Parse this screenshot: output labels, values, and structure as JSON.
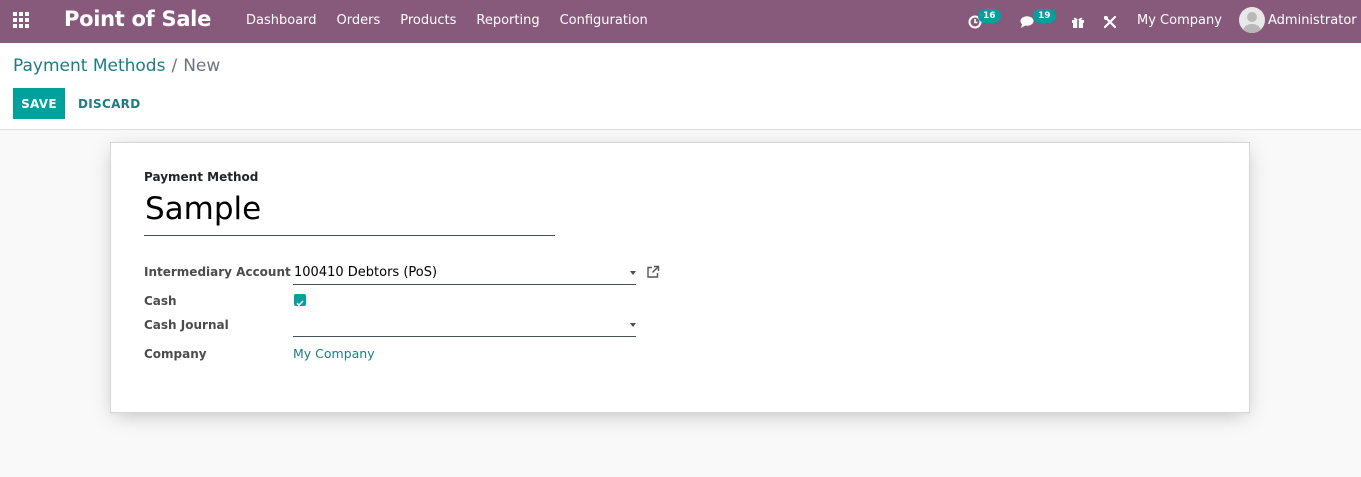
{
  "navbar": {
    "app_title": "Point of Sale",
    "menu": [
      "Dashboard",
      "Orders",
      "Products",
      "Reporting",
      "Configuration"
    ],
    "activity_count": "16",
    "message_count": "19",
    "company": "My Company",
    "user": "Administrator"
  },
  "breadcrumb": {
    "parent": "Payment Methods",
    "separator": "/",
    "current": "New"
  },
  "buttons": {
    "save": "SAVE",
    "discard": "DISCARD"
  },
  "form": {
    "name_label": "Payment Method",
    "name_value": "Sample",
    "intermediary_account_label": "Intermediary Account",
    "intermediary_account_value": "100410 Debtors (PoS)",
    "cash_label": "Cash",
    "cash_checked": true,
    "cash_journal_label": "Cash Journal",
    "cash_journal_value": "",
    "company_label": "Company",
    "company_value": "My Company"
  },
  "colors": {
    "navbar": "#875a7b",
    "primary": "#00a09d",
    "link": "#1f7b83"
  }
}
